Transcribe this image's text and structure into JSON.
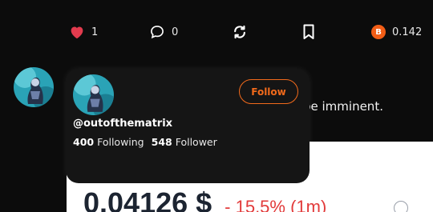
{
  "actions": {
    "likes": "1",
    "comments": "0",
    "tip_badge": "B",
    "tip_amount": "0.142"
  },
  "post": {
    "text_visible": "be imminent."
  },
  "price_card": {
    "price": "0.04126 $",
    "change": "- 15.5% (1m)"
  },
  "profile_card": {
    "handle": "@outofthematrix",
    "following_count": "400",
    "following_label": "Following",
    "follower_count": "548",
    "follower_label": "Follower",
    "follow_label": "Follow"
  },
  "colors": {
    "background": "#0c0c0c",
    "card": "#151515",
    "accent": "#f26a1b",
    "like": "#e23b4e",
    "negative": "#e23b3b"
  },
  "icons": [
    "heart-icon",
    "comment-icon",
    "repost-icon",
    "bookmark-icon",
    "bitcoin-icon",
    "info-icon"
  ]
}
